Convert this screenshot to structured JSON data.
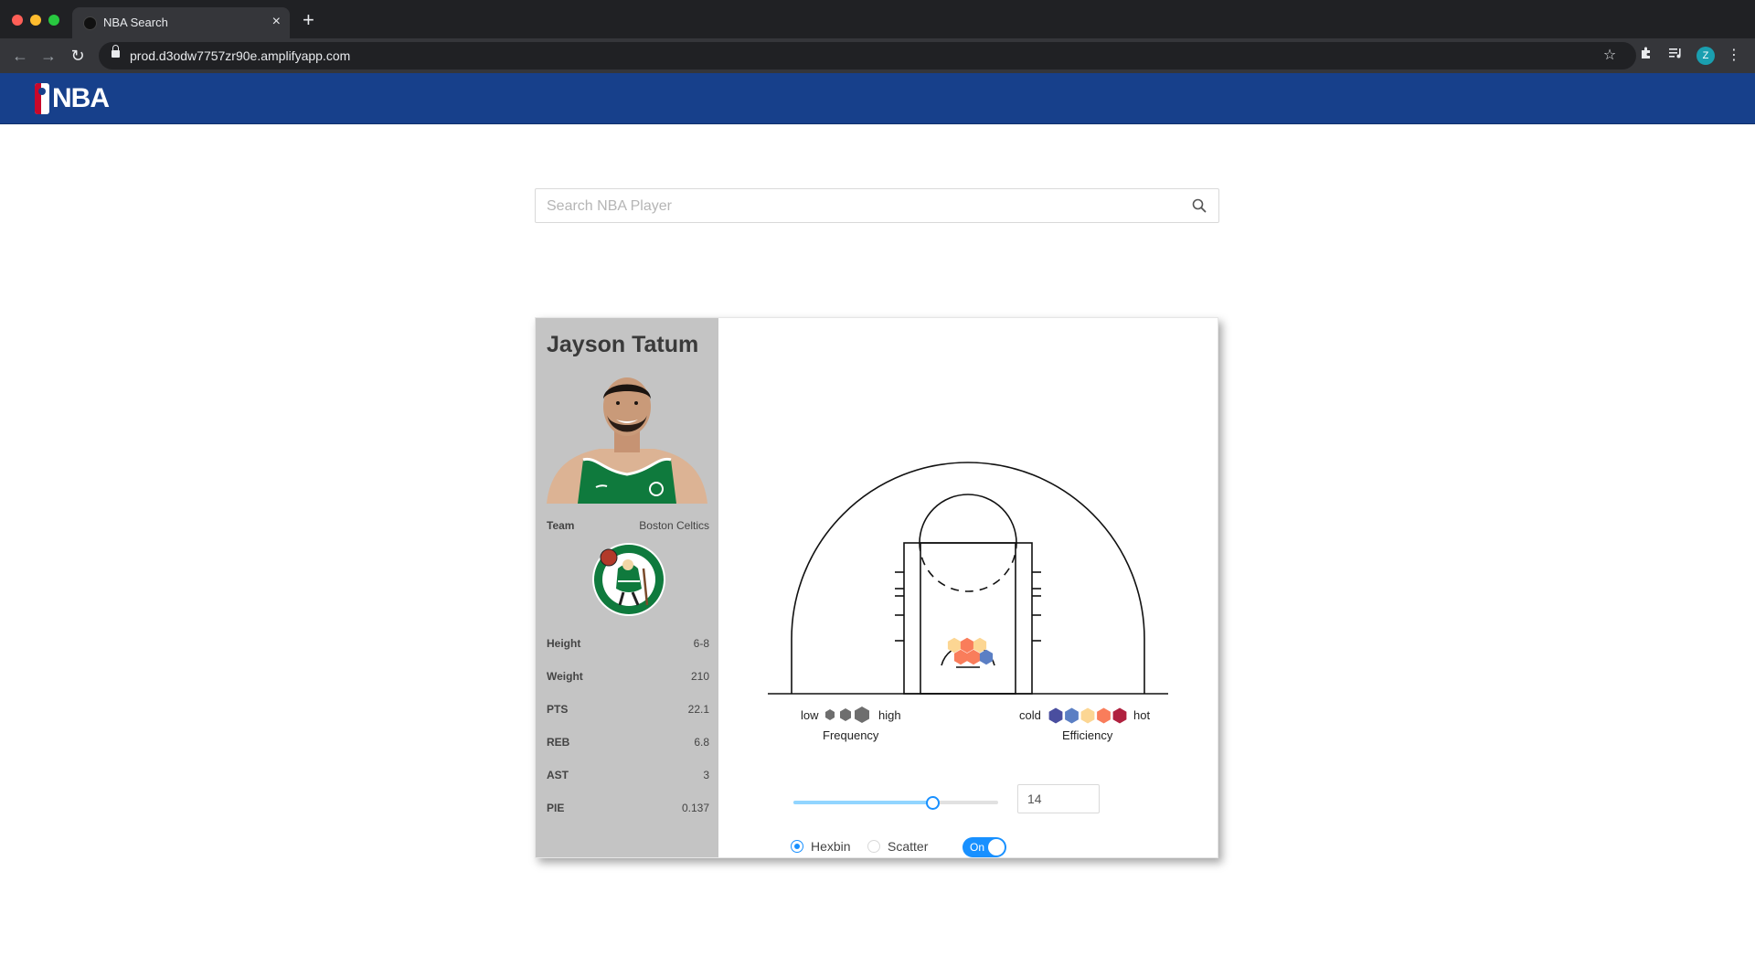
{
  "browser": {
    "tab_title": "NBA Search",
    "tab_close": "×",
    "new_tab": "+",
    "url": "prod.d3odw7757zr90e.amplifyapp.com",
    "profile_initial": "Z",
    "icons": [
      "back-arrow-icon",
      "forward-arrow-icon",
      "reload-icon",
      "lock-icon",
      "star-icon",
      "extensions-icon",
      "media-icon",
      "menu-icon"
    ]
  },
  "header": {
    "logo_text": "NBA",
    "colors": {
      "brand_blue": "#17408b",
      "brand_red": "#c9082a"
    }
  },
  "search": {
    "placeholder": "Search NBA Player",
    "value": ""
  },
  "player": {
    "name": "Jayson Tatum",
    "team_label": "Team",
    "team": "Boston Celtics",
    "stats": [
      {
        "label": "Height",
        "value": "6-8"
      },
      {
        "label": "Weight",
        "value": "210"
      },
      {
        "label": "PTS",
        "value": "22.1"
      },
      {
        "label": "REB",
        "value": "6.8"
      },
      {
        "label": "AST",
        "value": "3"
      },
      {
        "label": "PIE",
        "value": "0.137"
      }
    ],
    "team_logo_lettering": "BOSTON CELTICS"
  },
  "legend": {
    "frequency_low": "low",
    "frequency_high": "high",
    "frequency_title": "Frequency",
    "efficiency_cold": "cold",
    "efficiency_hot": "hot",
    "efficiency_title": "Efficiency",
    "efficiency_colors": [
      "#4a4e9f",
      "#5b7fc4",
      "#fcd693",
      "#f97d5b",
      "#b0213f"
    ],
    "frequency_color": "#6e6e6e"
  },
  "controls": {
    "slider_value": 14,
    "slider_fraction": 0.68,
    "number_input": "14",
    "radio_hexbin": "Hexbin",
    "radio_scatter": "Scatter",
    "selected_mode": "Hexbin",
    "switch_label": "On",
    "switch_on": true
  },
  "chart_data": {
    "type": "heatmap",
    "hexbins": [
      {
        "color": "#fcd693"
      },
      {
        "color": "#f97d5b"
      },
      {
        "color": "#fcd693"
      },
      {
        "color": "#f97d5b"
      },
      {
        "color": "#f97d5b"
      },
      {
        "color": "#5b7fc4"
      }
    ]
  }
}
